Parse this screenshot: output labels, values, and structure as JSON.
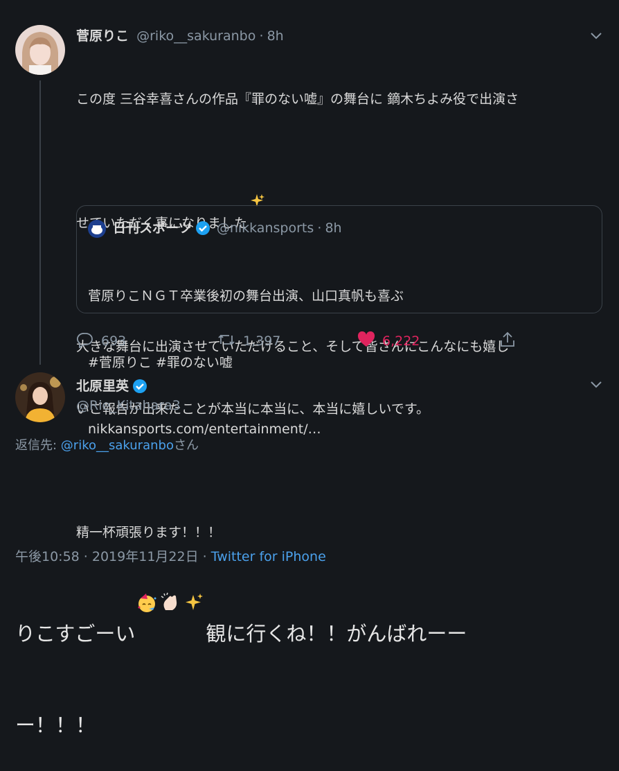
{
  "tweet1": {
    "author_name": "菅原りこ",
    "author_handle": "@riko__sakuranbo",
    "separator": "·",
    "time": "8h",
    "text_line1": "この度 三谷幸喜さんの作品『罪のない嘘』の舞台に 鏑木ちよみ役で出演さ",
    "text_line2": "せていただく事になりました",
    "text_line3": "大きな舞台に出演させていただけること、そして皆さんにこんなにも嬉し",
    "text_line4": "いご報告が出来たことが本当に本当に、本当に嬉しいです。",
    "text_line5": "精一杯頑張ります！！！",
    "quote": {
      "author_name": "日刊スポーツ",
      "author_handle": "@nikkansports",
      "time": "8h",
      "line1": "菅原りこＮＧＴ卒業後初の舞台出演、山口真帆も喜ぶ",
      "line2": "#菅原りこ #罪のない嘘",
      "line3": "nikkansports.com/entertainment/…"
    },
    "replies": "693",
    "retweets": "1,397",
    "likes": "6,222"
  },
  "tweet2": {
    "author_name": "北原里英",
    "author_handle": "@Rie_Kitahara3",
    "reply_to_prefix": "返信先: ",
    "reply_to_handle": "@riko__sakuranbo",
    "reply_to_suffix": "さん",
    "text_part1": "りこすごーい",
    "text_part2": "観に行くね！！がんばれーー",
    "text_line2": "ー！！！",
    "timestamp": "午後10:58 · 2019年11月22日",
    "dot": "·",
    "source": "Twitter for iPhone"
  },
  "colors": {
    "background": "#15181c",
    "link": "#4ba1ec",
    "like": "#e0245e",
    "verified": "#1da1f2",
    "muted": "#8b98a5"
  }
}
